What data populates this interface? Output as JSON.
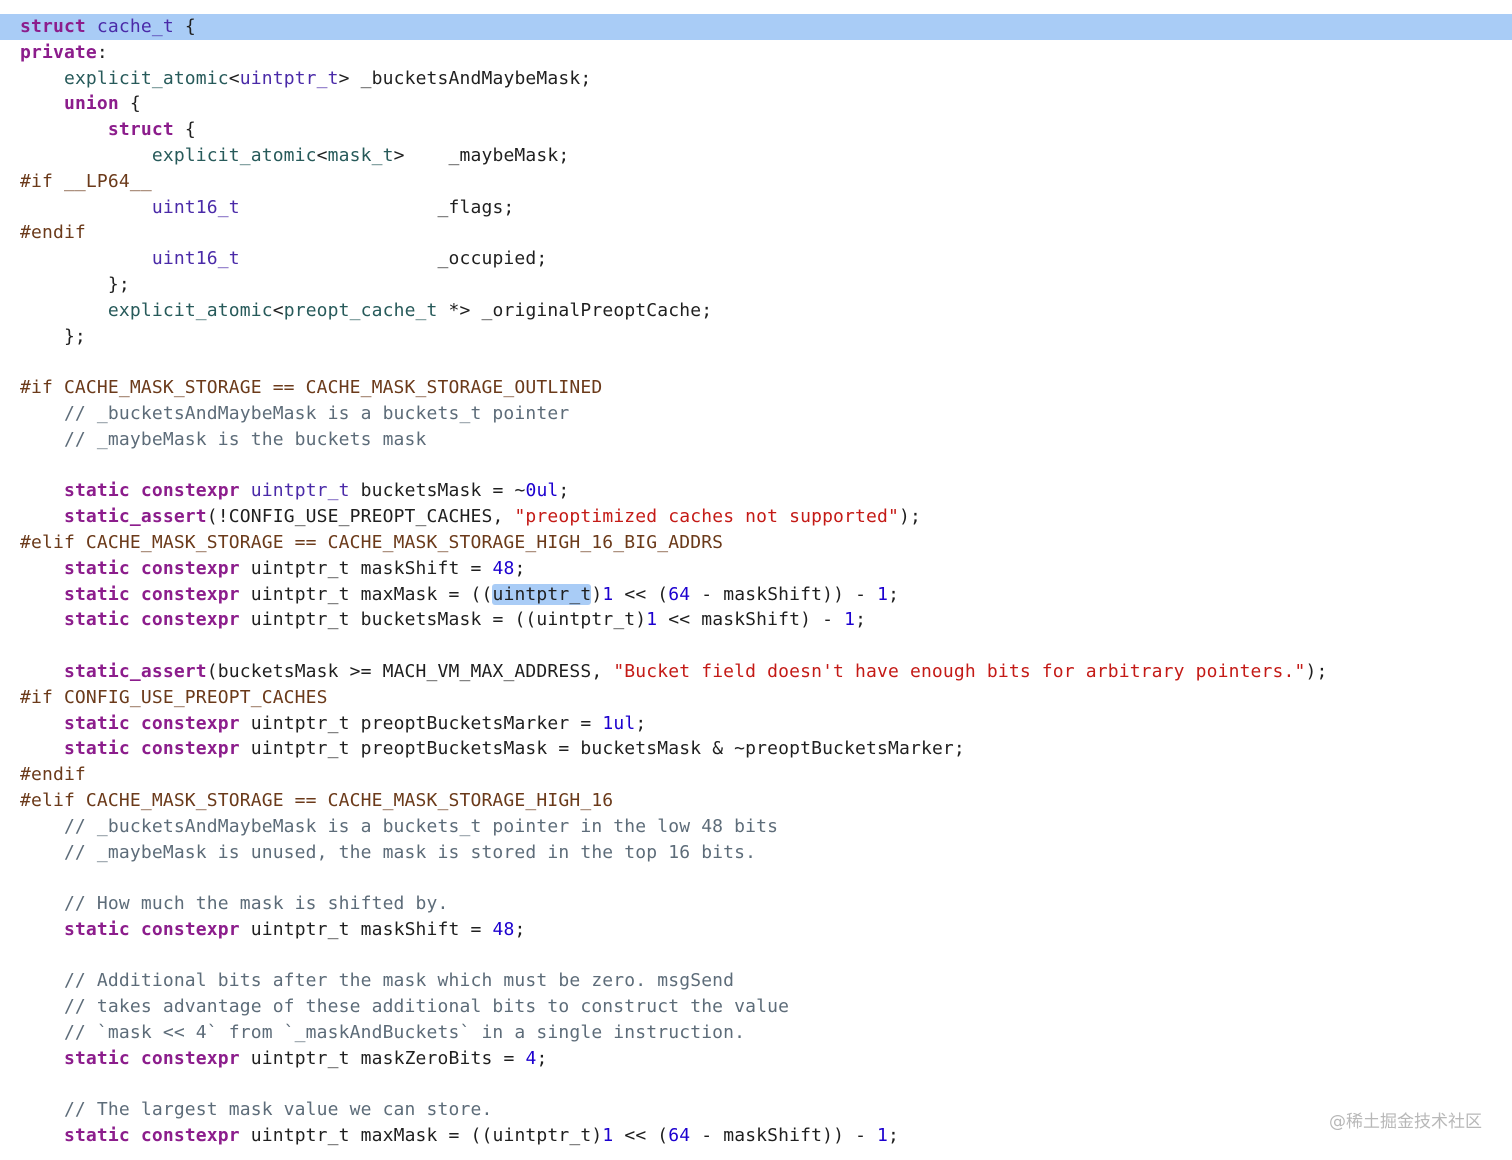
{
  "editor": {
    "lines": [
      {
        "segments": [
          {
            "t": "struct",
            "c": "kw"
          },
          {
            "t": " "
          },
          {
            "t": "cache_t",
            "c": "ty"
          },
          {
            "t": " {"
          }
        ],
        "highlight": true
      },
      {
        "segments": [
          {
            "t": "private",
            "c": "kw"
          },
          {
            "t": ":"
          }
        ]
      },
      {
        "segments": [
          {
            "t": "    "
          },
          {
            "t": "explicit_atomic",
            "c": "ty2"
          },
          {
            "t": "<"
          },
          {
            "t": "uintptr_t",
            "c": "ty"
          },
          {
            "t": "> _bucketsAndMaybeMask;"
          }
        ]
      },
      {
        "segments": [
          {
            "t": "    "
          },
          {
            "t": "union",
            "c": "kw"
          },
          {
            "t": " {"
          }
        ]
      },
      {
        "segments": [
          {
            "t": "        "
          },
          {
            "t": "struct",
            "c": "kw"
          },
          {
            "t": " {"
          }
        ]
      },
      {
        "segments": [
          {
            "t": "            "
          },
          {
            "t": "explicit_atomic",
            "c": "ty2"
          },
          {
            "t": "<"
          },
          {
            "t": "mask_t",
            "c": "ty2"
          },
          {
            "t": ">    _maybeMask;"
          }
        ]
      },
      {
        "segments": [
          {
            "t": "#if __LP64__",
            "c": "pp"
          }
        ]
      },
      {
        "segments": [
          {
            "t": "            "
          },
          {
            "t": "uint16_t",
            "c": "ty"
          },
          {
            "t": "                  _flags;"
          }
        ]
      },
      {
        "segments": [
          {
            "t": "#endif",
            "c": "pp"
          }
        ]
      },
      {
        "segments": [
          {
            "t": "            "
          },
          {
            "t": "uint16_t",
            "c": "ty"
          },
          {
            "t": "                  _occupied;"
          }
        ]
      },
      {
        "segments": [
          {
            "t": "        };"
          }
        ]
      },
      {
        "segments": [
          {
            "t": "        "
          },
          {
            "t": "explicit_atomic",
            "c": "ty2"
          },
          {
            "t": "<"
          },
          {
            "t": "preopt_cache_t",
            "c": "ty2"
          },
          {
            "t": " *> _originalPreoptCache;"
          }
        ]
      },
      {
        "segments": [
          {
            "t": "    };"
          }
        ]
      },
      {
        "segments": [
          {
            "t": ""
          }
        ]
      },
      {
        "segments": [
          {
            "t": "#if CACHE_MASK_STORAGE == CACHE_MASK_STORAGE_OUTLINED",
            "c": "pp"
          }
        ]
      },
      {
        "segments": [
          {
            "t": "    // _bucketsAndMaybeMask is a buckets_t pointer",
            "c": "cm"
          }
        ]
      },
      {
        "segments": [
          {
            "t": "    // _maybeMask is the buckets mask",
            "c": "cm"
          }
        ]
      },
      {
        "segments": [
          {
            "t": ""
          }
        ]
      },
      {
        "segments": [
          {
            "t": "    "
          },
          {
            "t": "static",
            "c": "kw"
          },
          {
            "t": " "
          },
          {
            "t": "constexpr",
            "c": "kw"
          },
          {
            "t": " "
          },
          {
            "t": "uintptr_t",
            "c": "ty"
          },
          {
            "t": " bucketsMask = ~"
          },
          {
            "t": "0ul",
            "c": "num"
          },
          {
            "t": ";"
          }
        ]
      },
      {
        "segments": [
          {
            "t": "    "
          },
          {
            "t": "static_assert",
            "c": "kw"
          },
          {
            "t": "(!CONFIG_USE_PREOPT_CACHES, "
          },
          {
            "t": "\"preoptimized caches not supported\"",
            "c": "str"
          },
          {
            "t": ");"
          }
        ]
      },
      {
        "segments": [
          {
            "t": "#elif CACHE_MASK_STORAGE == CACHE_MASK_STORAGE_HIGH_16_BIG_ADDRS",
            "c": "pp"
          }
        ]
      },
      {
        "segments": [
          {
            "t": "    "
          },
          {
            "t": "static",
            "c": "kw"
          },
          {
            "t": " "
          },
          {
            "t": "constexpr",
            "c": "kw"
          },
          {
            "t": " uintptr_t maskShift = "
          },
          {
            "t": "48",
            "c": "num"
          },
          {
            "t": ";"
          }
        ]
      },
      {
        "segments": [
          {
            "t": "    "
          },
          {
            "t": "static",
            "c": "kw"
          },
          {
            "t": " "
          },
          {
            "t": "constexpr",
            "c": "kw"
          },
          {
            "t": " uintptr_t maxMask = (("
          },
          {
            "t": "uintptr_t",
            "c": "sel"
          },
          {
            "t": ")"
          },
          {
            "t": "1",
            "c": "num"
          },
          {
            "t": " << ("
          },
          {
            "t": "64",
            "c": "num"
          },
          {
            "t": " - maskShift)) - "
          },
          {
            "t": "1",
            "c": "num"
          },
          {
            "t": ";"
          }
        ]
      },
      {
        "segments": [
          {
            "t": "    "
          },
          {
            "t": "static",
            "c": "kw"
          },
          {
            "t": " "
          },
          {
            "t": "constexpr",
            "c": "kw"
          },
          {
            "t": " uintptr_t bucketsMask = ((uintptr_t)"
          },
          {
            "t": "1",
            "c": "num"
          },
          {
            "t": " << maskShift) - "
          },
          {
            "t": "1",
            "c": "num"
          },
          {
            "t": ";"
          }
        ]
      },
      {
        "segments": [
          {
            "t": ""
          }
        ]
      },
      {
        "segments": [
          {
            "t": "    "
          },
          {
            "t": "static_assert",
            "c": "kw"
          },
          {
            "t": "(bucketsMask >= MACH_VM_MAX_ADDRESS, "
          },
          {
            "t": "\"Bucket field doesn't have enough bits for arbitrary pointers.\"",
            "c": "str"
          },
          {
            "t": ");"
          }
        ]
      },
      {
        "segments": [
          {
            "t": "#if CONFIG_USE_PREOPT_CACHES",
            "c": "pp"
          }
        ]
      },
      {
        "segments": [
          {
            "t": "    "
          },
          {
            "t": "static",
            "c": "kw"
          },
          {
            "t": " "
          },
          {
            "t": "constexpr",
            "c": "kw"
          },
          {
            "t": " uintptr_t preoptBucketsMarker = "
          },
          {
            "t": "1ul",
            "c": "num"
          },
          {
            "t": ";"
          }
        ]
      },
      {
        "segments": [
          {
            "t": "    "
          },
          {
            "t": "static",
            "c": "kw"
          },
          {
            "t": " "
          },
          {
            "t": "constexpr",
            "c": "kw"
          },
          {
            "t": " uintptr_t preoptBucketsMask = bucketsMask & ~preoptBucketsMarker;"
          }
        ]
      },
      {
        "segments": [
          {
            "t": "#endif",
            "c": "pp"
          }
        ]
      },
      {
        "segments": [
          {
            "t": "#elif CACHE_MASK_STORAGE == CACHE_MASK_STORAGE_HIGH_16",
            "c": "pp"
          }
        ]
      },
      {
        "segments": [
          {
            "t": "    // _bucketsAndMaybeMask is a buckets_t pointer in the low 48 bits",
            "c": "cm"
          }
        ]
      },
      {
        "segments": [
          {
            "t": "    // _maybeMask is unused, the mask is stored in the top 16 bits.",
            "c": "cm"
          }
        ]
      },
      {
        "segments": [
          {
            "t": ""
          }
        ]
      },
      {
        "segments": [
          {
            "t": "    // How much the mask is shifted by.",
            "c": "cm"
          }
        ]
      },
      {
        "segments": [
          {
            "t": "    "
          },
          {
            "t": "static",
            "c": "kw"
          },
          {
            "t": " "
          },
          {
            "t": "constexpr",
            "c": "kw"
          },
          {
            "t": " uintptr_t maskShift = "
          },
          {
            "t": "48",
            "c": "num"
          },
          {
            "t": ";"
          }
        ]
      },
      {
        "segments": [
          {
            "t": ""
          }
        ]
      },
      {
        "segments": [
          {
            "t": "    // Additional bits after the mask which must be zero. msgSend",
            "c": "cm"
          }
        ]
      },
      {
        "segments": [
          {
            "t": "    // takes advantage of these additional bits to construct the value",
            "c": "cm"
          }
        ]
      },
      {
        "segments": [
          {
            "t": "    // `mask << 4` from `_maskAndBuckets` in a single instruction.",
            "c": "cm"
          }
        ]
      },
      {
        "segments": [
          {
            "t": "    "
          },
          {
            "t": "static",
            "c": "kw"
          },
          {
            "t": " "
          },
          {
            "t": "constexpr",
            "c": "kw"
          },
          {
            "t": " uintptr_t maskZeroBits = "
          },
          {
            "t": "4",
            "c": "num"
          },
          {
            "t": ";"
          }
        ]
      },
      {
        "segments": [
          {
            "t": ""
          }
        ]
      },
      {
        "segments": [
          {
            "t": "    // The largest mask value we can store.",
            "c": "cm"
          }
        ]
      },
      {
        "segments": [
          {
            "t": "    "
          },
          {
            "t": "static",
            "c": "kw"
          },
          {
            "t": " "
          },
          {
            "t": "constexpr",
            "c": "kw"
          },
          {
            "t": " uintptr_t maxMask = ((uintptr_t)"
          },
          {
            "t": "1",
            "c": "num"
          },
          {
            "t": " << ("
          },
          {
            "t": "64",
            "c": "num"
          },
          {
            "t": " - maskShift)) - "
          },
          {
            "t": "1",
            "c": "num"
          },
          {
            "t": ";"
          }
        ]
      }
    ]
  },
  "watermark": "@稀土掘金技术社区"
}
